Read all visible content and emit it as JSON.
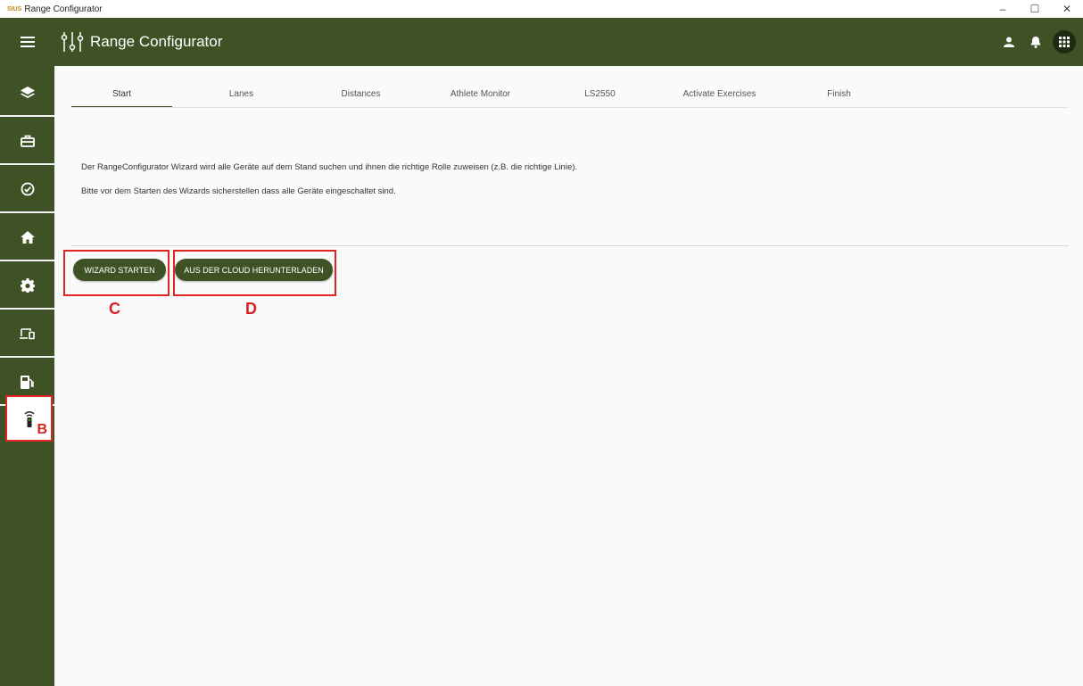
{
  "window": {
    "logo": "SIUS",
    "title": "Range Configurator",
    "controls": [
      "–",
      "☐",
      "✕"
    ]
  },
  "appbar": {
    "title": "Range Configurator"
  },
  "sidebar": {
    "items": [
      {
        "icon": "layers-icon"
      },
      {
        "icon": "briefcase-icon"
      },
      {
        "icon": "check-circle-icon"
      },
      {
        "icon": "home-icon"
      },
      {
        "icon": "gear-icon"
      },
      {
        "icon": "devices-icon"
      },
      {
        "icon": "fuel-station-icon"
      },
      {
        "icon": "remote-icon",
        "active": true
      }
    ]
  },
  "tabs": [
    {
      "label": "Start",
      "active": true
    },
    {
      "label": "Lanes"
    },
    {
      "label": "Distances"
    },
    {
      "label": "Athlete Monitor"
    },
    {
      "label": "LS2550"
    },
    {
      "label": "Activate Exercises"
    },
    {
      "label": "Finish"
    }
  ],
  "content": {
    "paragraph1": "Der RangeConfigurator Wizard wird alle Geräte auf dem Stand suchen und ihnen die richtige Rolle zuweisen (z.B. die richtige Linie).",
    "paragraph2": "Bitte vor dem Starten des Wizards sicherstellen dass alle Geräte eingeschaltet sind.",
    "start_button": "WIZARD STARTEN",
    "download_button": "AUS DER CLOUD HERUNTERLADEN"
  },
  "annotations": {
    "b": "B",
    "c": "C",
    "d": "D",
    "color": "#e02424"
  },
  "colors": {
    "primary": "#3f5226",
    "background": "#fafafa"
  }
}
